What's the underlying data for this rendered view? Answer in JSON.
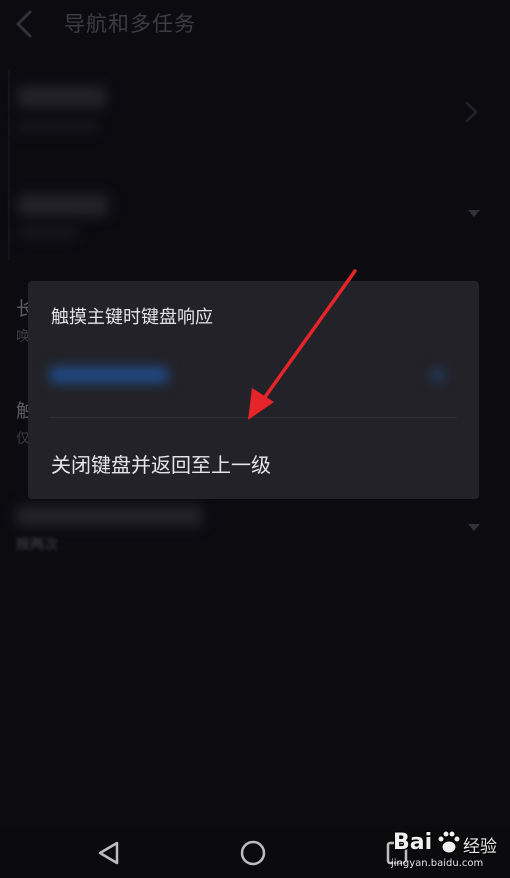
{
  "header": {
    "title": "导航和多任务",
    "back_icon": "chevron-left-icon"
  },
  "background": {
    "peek_chars": [
      "长",
      "触"
    ],
    "peek_subs": [
      "唤",
      "仅"
    ],
    "peek_bottom_sub": "按两次"
  },
  "dialog": {
    "title": "触摸主键时键盘响应",
    "option_close_keyboard": "关闭键盘并返回至上一级"
  },
  "navbar": {
    "icons": [
      "back-triangle-icon",
      "home-circle-icon",
      "recents-square-icon"
    ]
  },
  "watermark": {
    "brand_bai": "Bai",
    "brand_jingyan": "经验",
    "url": "jingyan.baidu.com"
  },
  "colors": {
    "background": "#0f0e14",
    "dialog": "#232228",
    "accent_blue": "#1f4c8a",
    "annotation_red": "#e5252a"
  }
}
